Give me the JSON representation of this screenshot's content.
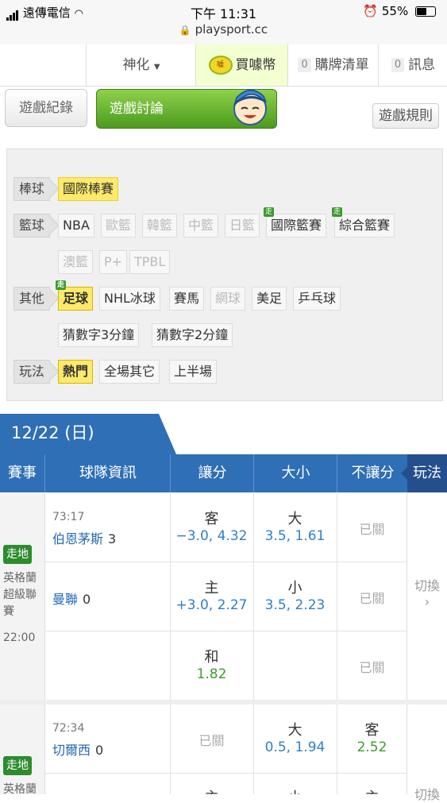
{
  "status_bar": {
    "carrier": "遠傳電信",
    "time": "下午 11:31",
    "battery": "55%",
    "url": "playsport.cc"
  },
  "nav": {
    "shenhua": "神化",
    "buy_coin": "買噱幣",
    "coin_badge": "噱",
    "list_count": "0",
    "list_label": "購牌清單",
    "msg_count": "0",
    "msg_label": "訊息"
  },
  "tabs": {
    "record": "遊戲紀錄",
    "discussion": "遊戲討論",
    "rules": "遊戲規則"
  },
  "filters": {
    "baseball": {
      "label": "棒球",
      "items": [
        "國際棒賽"
      ]
    },
    "basketball": {
      "label": "籃球",
      "items": [
        "NBA",
        "歐籃",
        "韓籃",
        "中籃",
        "日籃",
        "國際籃賽",
        "綜合籃賽",
        "澳籃",
        "P+",
        "TPBL"
      ]
    },
    "other": {
      "label": "其他",
      "items": [
        "足球",
        "NHL冰球",
        "賽馬",
        "網球",
        "美足",
        "乒乓球",
        "猜數字3分鐘",
        "猜數字2分鐘"
      ]
    },
    "play": {
      "label": "玩法",
      "items": [
        "熱門",
        "全場其它",
        "上半場"
      ]
    },
    "walk_badge": "走"
  },
  "date": "12/22 (日)",
  "table_header": {
    "event": "賽事",
    "team_info": "球隊資訊",
    "handicap": "讓分",
    "total": "大小",
    "moneyline": "不讓分",
    "play": "玩法"
  },
  "games": [
    {
      "status": "走地",
      "league": "英格蘭超級聯賽",
      "kickoff": "22:00",
      "clock": "73:17",
      "switch": "切換",
      "rows": [
        {
          "team": "伯恩茅斯",
          "score": "3",
          "hc_side": "客",
          "hc_odds": "−3.0, 4.32",
          "ou_side": "大",
          "ou_odds": "3.5, 1.61",
          "ml": "已關"
        },
        {
          "team": "曼聯",
          "score": "0",
          "hc_side": "主",
          "hc_odds": "+3.0, 2.27",
          "ou_side": "小",
          "ou_odds": "3.5, 2.23",
          "ml": "已關"
        },
        {
          "draw_side": "和",
          "draw_odds": "1.82",
          "ml": "已關"
        }
      ]
    },
    {
      "status": "走地",
      "league": "英格蘭",
      "clock": "72:34",
      "switch": "切換",
      "rows": [
        {
          "team": "切爾西",
          "score": "0",
          "hc": "已關",
          "ou_side": "大",
          "ou_odds": "0.5, 1.94",
          "ml_side": "客",
          "ml_odds": "2.52"
        },
        {
          "hc_side": "主",
          "ou_side": "小",
          "ml_side": "主"
        }
      ]
    }
  ]
}
